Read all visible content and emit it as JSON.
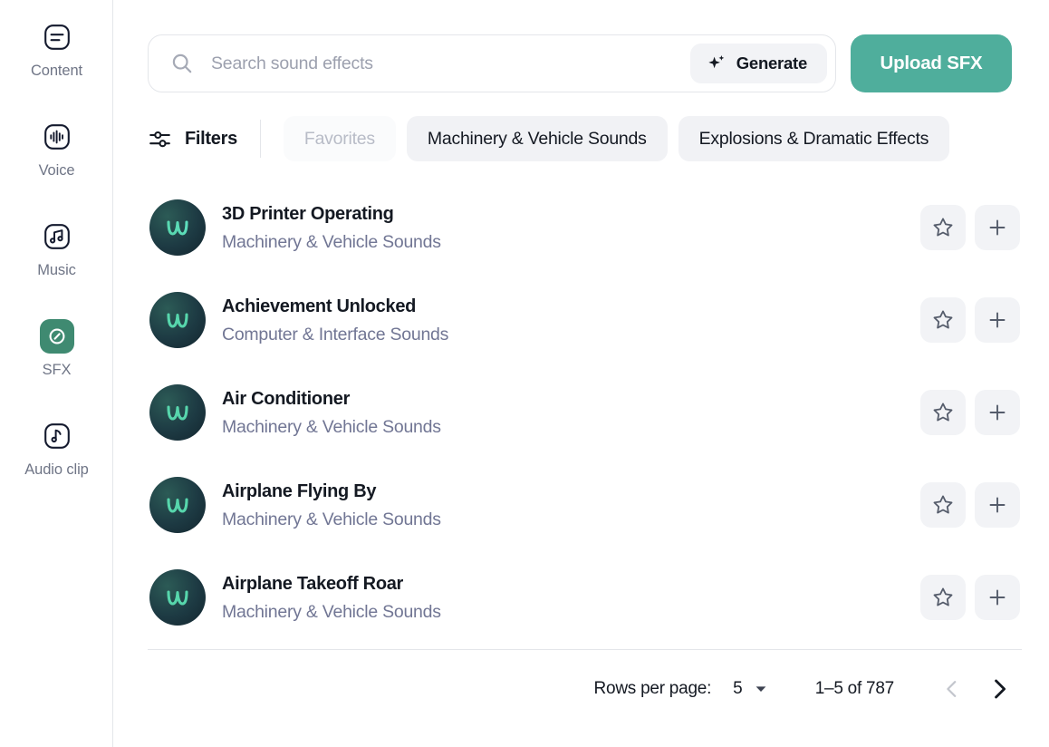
{
  "sidebar": {
    "items": [
      {
        "label": "Content",
        "icon": "content-icon",
        "active": false
      },
      {
        "label": "Voice",
        "icon": "voice-icon",
        "active": false
      },
      {
        "label": "Music",
        "icon": "music-icon",
        "active": false
      },
      {
        "label": "SFX",
        "icon": "sfx-icon",
        "active": true
      },
      {
        "label": "Audio clip",
        "icon": "audio-clip-icon",
        "active": false
      }
    ]
  },
  "search": {
    "placeholder": "Search sound effects",
    "value": "",
    "icon": "search-icon",
    "generate_label": "Generate",
    "generate_icon": "sparkle-icon",
    "upload_label": "Upload SFX"
  },
  "filters": {
    "label": "Filters",
    "icon": "tune-icon",
    "chips": [
      {
        "label": "Favorites",
        "muted": true
      },
      {
        "label": "Machinery & Vehicle Sounds",
        "muted": false
      },
      {
        "label": "Explosions & Dramatic Effects",
        "muted": false
      }
    ]
  },
  "list": {
    "favorite_icon": "star-icon",
    "add_icon": "plus-icon",
    "avatar_icon": "wave-logo-icon",
    "rows": [
      {
        "title": "3D Printer Operating",
        "category": "Machinery & Vehicle Sounds"
      },
      {
        "title": "Achievement Unlocked",
        "category": "Computer & Interface Sounds"
      },
      {
        "title": "Air Conditioner",
        "category": "Machinery & Vehicle Sounds"
      },
      {
        "title": "Airplane Flying By",
        "category": "Machinery & Vehicle Sounds"
      },
      {
        "title": "Airplane Takeoff Roar",
        "category": "Machinery & Vehicle Sounds"
      }
    ]
  },
  "pagination": {
    "rows_per_page_label": "Rows per page:",
    "rows_per_page_value": "5",
    "range_label": "1–5 of 787",
    "prev_icon": "chevron-left-icon",
    "next_icon": "chevron-right-icon",
    "prev_disabled": true,
    "next_disabled": false
  },
  "colors": {
    "accent": "#4fae9c",
    "active_nav": "#3f8a71",
    "text": "#141922",
    "muted_text": "#717694",
    "chip_bg": "#f1f2f5",
    "border": "#e4e6ea"
  }
}
